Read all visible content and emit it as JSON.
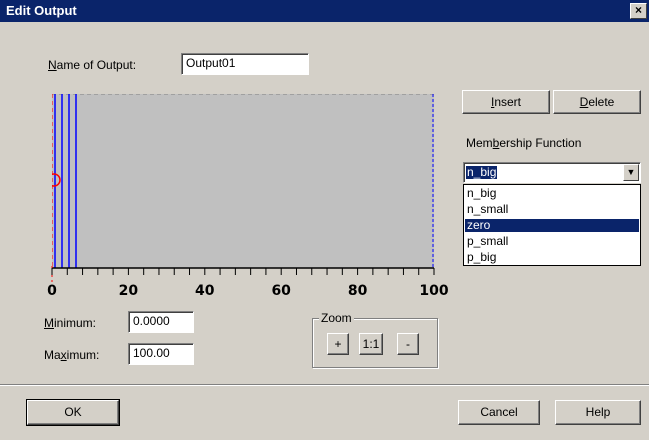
{
  "window": {
    "title": "Edit Output",
    "close_label": "×"
  },
  "name_field": {
    "label_prefix": "N",
    "label_rest": "ame of Output:",
    "value": "Output01"
  },
  "buttons": {
    "insert_u": "I",
    "insert_rest": "nsert",
    "delete_u": "D",
    "delete_rest": "elete",
    "ok": "OK",
    "cancel": "Cancel",
    "help": "Help"
  },
  "membership": {
    "label_a": "Mem",
    "label_u": "b",
    "label_b": "ership Function",
    "selected": "n_big",
    "options": [
      "n_big",
      "n_small",
      "zero",
      "p_small",
      "p_big"
    ],
    "highlighted_index": 2
  },
  "plot": {
    "x_ticks": [
      "0",
      "20",
      "40",
      "60",
      "80",
      "100"
    ],
    "colors": {
      "curve": "#0000ff",
      "left_edge": "#ff0000",
      "marker": "#ff0000",
      "border": "#808080"
    }
  },
  "range": {
    "min_u": "M",
    "min_rest": "inimum:",
    "min_value": "0.0000",
    "max_a": "Ma",
    "max_u": "x",
    "max_rest": "imum:",
    "max_value": "100.00"
  },
  "zoom": {
    "title": "Zoom",
    "plus": "+",
    "one_to_one": "1:1",
    "minus": "-"
  }
}
